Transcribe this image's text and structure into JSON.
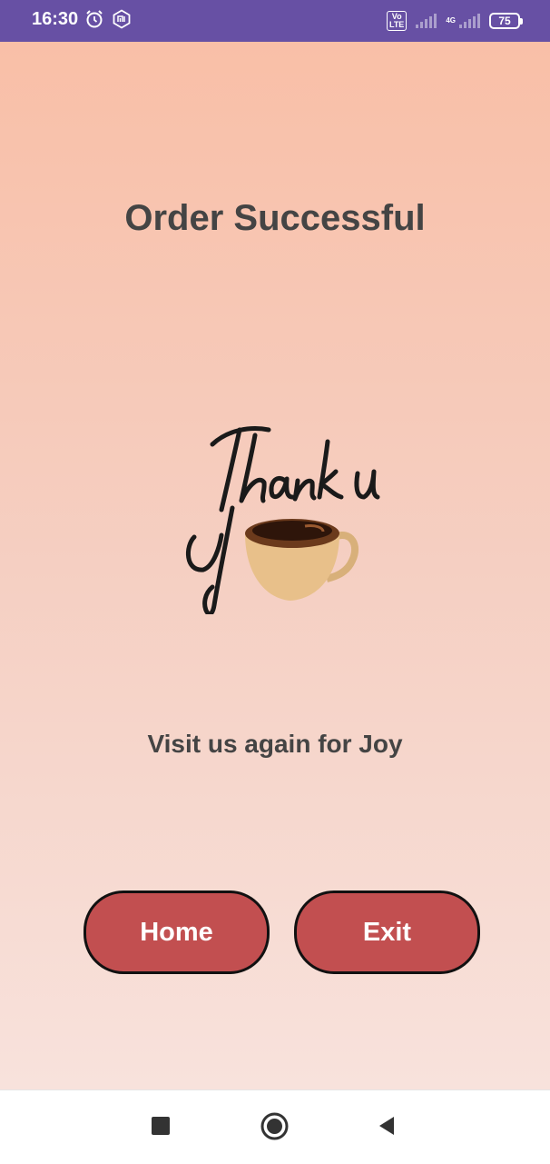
{
  "status_bar": {
    "time": "16:30",
    "left_icons": [
      "alarm-icon",
      "mi-icon"
    ],
    "volte_label": "Vo\nLTE",
    "network_label": "4G",
    "battery": "75",
    "colors": {
      "background": "#6750a4",
      "text": "#ffffff"
    }
  },
  "main": {
    "title": "Order Successful",
    "graphic": {
      "text": "Thank you",
      "icon": "coffee-cup-icon"
    },
    "subtitle": "Visit us again for Joy",
    "buttons": {
      "home_label": "Home",
      "exit_label": "Exit"
    },
    "colors": {
      "gradient_top": "#f9bfa7",
      "gradient_bottom": "#f8e2dc",
      "button": "#c24f50",
      "text": "#444444"
    }
  },
  "nav_bar": {
    "icons": [
      "recents-square-icon",
      "home-circle-icon",
      "back-triangle-icon"
    ]
  }
}
